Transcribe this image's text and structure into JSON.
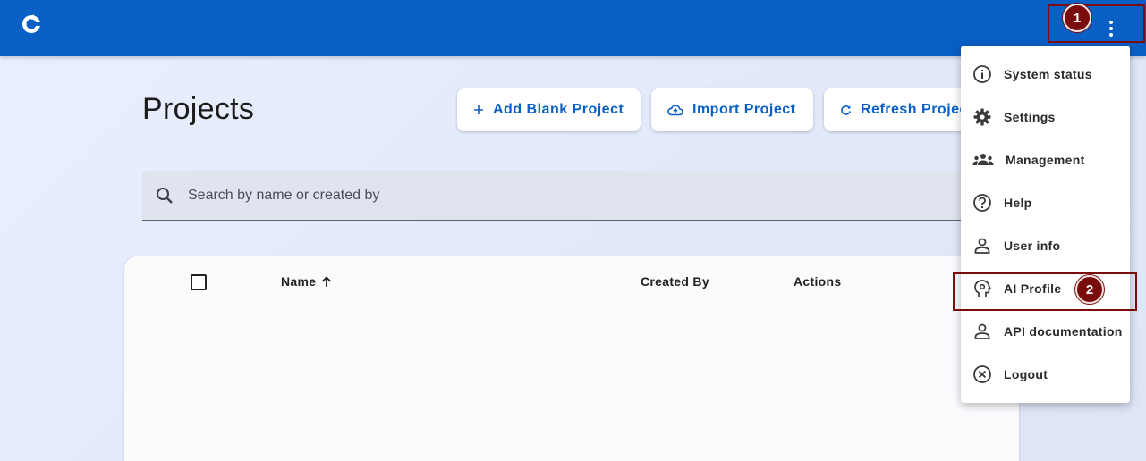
{
  "page": {
    "title": "Projects"
  },
  "actions": {
    "add_blank": "Add Blank Project",
    "import": "Import Project",
    "refresh": "Refresh Projects"
  },
  "search": {
    "placeholder": "Search by name or created by"
  },
  "table": {
    "columns": {
      "name": "Name",
      "created_by": "Created By",
      "actions": "Actions"
    }
  },
  "menu": {
    "items": [
      {
        "label": "System status",
        "icon": "info-icon"
      },
      {
        "label": "Settings",
        "icon": "gear-icon"
      },
      {
        "label": "Management",
        "icon": "group-icon"
      },
      {
        "label": "Help",
        "icon": "help-icon"
      },
      {
        "label": "User info",
        "icon": "person-icon"
      },
      {
        "label": "AI Profile",
        "icon": "ai-head-icon"
      },
      {
        "label": "API documentation",
        "icon": "person-icon"
      },
      {
        "label": "Logout",
        "icon": "close-circle-icon"
      }
    ]
  },
  "annotations": {
    "badge_1": "1",
    "badge_2": "2"
  },
  "colors": {
    "primary": "#0a5fc4",
    "annotation": "#7a0c0c"
  }
}
